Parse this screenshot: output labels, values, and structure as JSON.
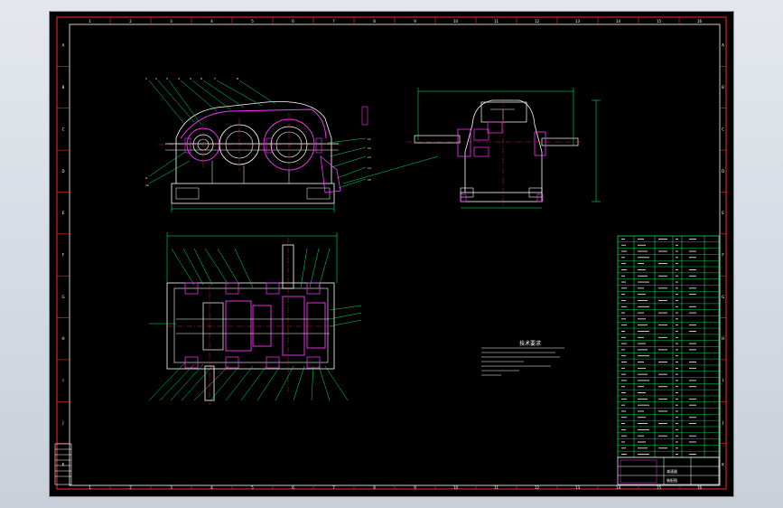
{
  "drawing": {
    "background": "#000000",
    "border_color": "#ff2a2a",
    "frame_color": "#ffffff",
    "geometry_color": "#ffffff",
    "part_color": "#ff33ff",
    "centerline_color": "#ff3333",
    "dimension_color": "#00ff66",
    "leader_color": "#00ff66",
    "table_color": "#00ff66"
  },
  "zones": {
    "columns": [
      "1",
      "2",
      "3",
      "4",
      "5",
      "6",
      "7",
      "8",
      "9",
      "10",
      "11",
      "12",
      "13",
      "14",
      "15",
      "16"
    ],
    "rows": [
      "A",
      "B",
      "C",
      "D",
      "E",
      "F",
      "G",
      "H",
      "I",
      "J",
      "K"
    ]
  },
  "technical_requirements": {
    "title": "技术要求"
  },
  "title_block": {
    "label_a": "减速器",
    "label_b": "装配图"
  }
}
